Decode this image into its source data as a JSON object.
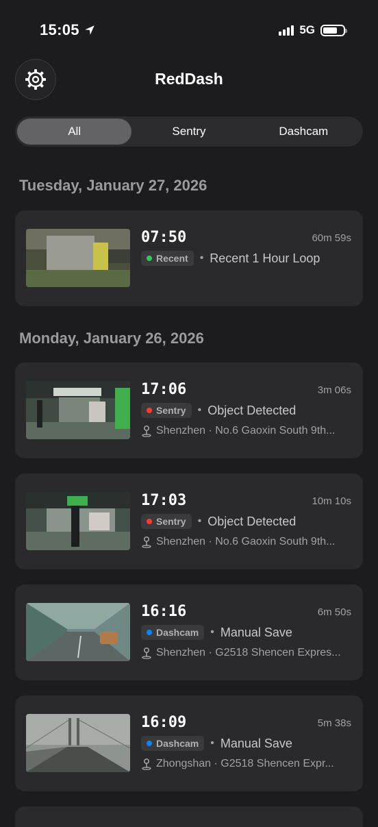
{
  "status": {
    "time": "15:05",
    "network": "5G"
  },
  "header": {
    "title": "RedDash"
  },
  "tabs": [
    {
      "label": "All",
      "active": true
    },
    {
      "label": "Sentry",
      "active": false
    },
    {
      "label": "Dashcam",
      "active": false
    }
  ],
  "sections": [
    {
      "date": "Tuesday, January 27, 2026",
      "clips": [
        {
          "time": "07:50",
          "duration": "60m 59s",
          "badge": "Recent",
          "badge_color": "#34c759",
          "event": "Recent 1 Hour Loop",
          "location": ""
        }
      ]
    },
    {
      "date": "Monday, January 26, 2026",
      "clips": [
        {
          "time": "17:06",
          "duration": "3m 06s",
          "badge": "Sentry",
          "badge_color": "#ff3b30",
          "event": "Object Detected",
          "location": "Shenzhen · No.6 Gaoxin South 9th..."
        },
        {
          "time": "17:03",
          "duration": "10m 10s",
          "badge": "Sentry",
          "badge_color": "#ff3b30",
          "event": "Object Detected",
          "location": "Shenzhen · No.6 Gaoxin South 9th..."
        },
        {
          "time": "16:16",
          "duration": "6m 50s",
          "badge": "Dashcam",
          "badge_color": "#0a84ff",
          "event": "Manual Save",
          "location": "Shenzhen · G2518 Shencen Expres..."
        },
        {
          "time": "16:09",
          "duration": "5m 38s",
          "badge": "Dashcam",
          "badge_color": "#0a84ff",
          "event": "Manual Save",
          "location": "Zhongshan · G2518 Shencen Expr..."
        }
      ]
    }
  ],
  "icons": {
    "settings": "gear-icon",
    "location": "pin-icon",
    "nav": "location-arrow-icon"
  }
}
